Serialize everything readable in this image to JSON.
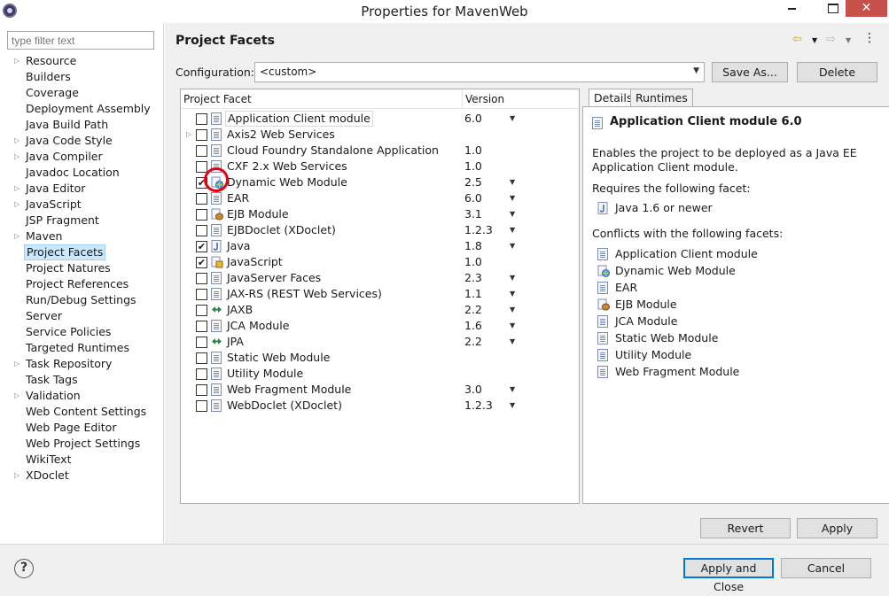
{
  "window": {
    "title": "Properties for MavenWeb",
    "close_glyph": "✕"
  },
  "sidebar": {
    "filter_placeholder": "type filter text",
    "items": [
      {
        "label": "Resource",
        "expandable": true
      },
      {
        "label": "Builders",
        "expandable": false
      },
      {
        "label": "Coverage",
        "expandable": false
      },
      {
        "label": "Deployment Assembly",
        "expandable": false
      },
      {
        "label": "Java Build Path",
        "expandable": false
      },
      {
        "label": "Java Code Style",
        "expandable": true
      },
      {
        "label": "Java Compiler",
        "expandable": true
      },
      {
        "label": "Javadoc Location",
        "expandable": false
      },
      {
        "label": "Java Editor",
        "expandable": true
      },
      {
        "label": "JavaScript",
        "expandable": true
      },
      {
        "label": "JSP Fragment",
        "expandable": false
      },
      {
        "label": "Maven",
        "expandable": true
      },
      {
        "label": "Project Facets",
        "expandable": false,
        "selected": true
      },
      {
        "label": "Project Natures",
        "expandable": false
      },
      {
        "label": "Project References",
        "expandable": false
      },
      {
        "label": "Run/Debug Settings",
        "expandable": false
      },
      {
        "label": "Server",
        "expandable": false
      },
      {
        "label": "Service Policies",
        "expandable": false
      },
      {
        "label": "Targeted Runtimes",
        "expandable": false
      },
      {
        "label": "Task Repository",
        "expandable": true
      },
      {
        "label": "Task Tags",
        "expandable": false
      },
      {
        "label": "Validation",
        "expandable": true
      },
      {
        "label": "Web Content Settings",
        "expandable": false
      },
      {
        "label": "Web Page Editor",
        "expandable": false
      },
      {
        "label": "Web Project Settings",
        "expandable": false
      },
      {
        "label": "WikiText",
        "expandable": false
      },
      {
        "label": "XDoclet",
        "expandable": true
      }
    ]
  },
  "main": {
    "title": "Project Facets",
    "configuration_label": "Configuration:",
    "configuration_value": "<custom>",
    "save_as_label": "Save As...",
    "delete_label": "Delete",
    "facets_header": "Project Facet",
    "version_header": "Version",
    "facets": [
      {
        "name": "Application Client module",
        "version": "6.0",
        "checked": false,
        "dropdown": true,
        "boxed": true,
        "expandable": false,
        "icon": "page-icon"
      },
      {
        "name": "Axis2 Web Services",
        "version": "",
        "checked": false,
        "dropdown": false,
        "expandable": true,
        "icon": "page-icon"
      },
      {
        "name": "Cloud Foundry Standalone Application",
        "version": "1.0",
        "checked": false,
        "dropdown": false,
        "expandable": false,
        "icon": "page-icon"
      },
      {
        "name": "CXF 2.x Web Services",
        "version": "1.0",
        "checked": false,
        "dropdown": false,
        "expandable": false,
        "icon": "page-icon"
      },
      {
        "name": "Dynamic Web Module",
        "version": "2.5",
        "checked": true,
        "dropdown": true,
        "expandable": false,
        "icon": "globe-page-icon"
      },
      {
        "name": "EAR",
        "version": "6.0",
        "checked": false,
        "dropdown": true,
        "expandable": false,
        "icon": "page-icon"
      },
      {
        "name": "EJB Module",
        "version": "3.1",
        "checked": false,
        "dropdown": true,
        "expandable": false,
        "icon": "bean-icon"
      },
      {
        "name": "EJBDoclet (XDoclet)",
        "version": "1.2.3",
        "checked": false,
        "dropdown": true,
        "expandable": false,
        "icon": "page-icon"
      },
      {
        "name": "Java",
        "version": "1.8",
        "checked": true,
        "dropdown": true,
        "expandable": false,
        "icon": "java-page-icon"
      },
      {
        "name": "JavaScript",
        "version": "1.0",
        "checked": true,
        "dropdown": false,
        "expandable": false,
        "icon": "js-icon"
      },
      {
        "name": "JavaServer Faces",
        "version": "2.3",
        "checked": false,
        "dropdown": true,
        "expandable": false,
        "icon": "page-icon"
      },
      {
        "name": "JAX-RS (REST Web Services)",
        "version": "1.1",
        "checked": false,
        "dropdown": true,
        "expandable": false,
        "icon": "page-icon"
      },
      {
        "name": "JAXB",
        "version": "2.2",
        "checked": false,
        "dropdown": true,
        "expandable": false,
        "icon": "arrows-icon"
      },
      {
        "name": "JCA Module",
        "version": "1.6",
        "checked": false,
        "dropdown": true,
        "expandable": false,
        "icon": "page-icon"
      },
      {
        "name": "JPA",
        "version": "2.2",
        "checked": false,
        "dropdown": true,
        "expandable": false,
        "icon": "arrows-icon"
      },
      {
        "name": "Static Web Module",
        "version": "",
        "checked": false,
        "dropdown": false,
        "expandable": false,
        "icon": "page-icon"
      },
      {
        "name": "Utility Module",
        "version": "",
        "checked": false,
        "dropdown": false,
        "expandable": false,
        "icon": "page-icon"
      },
      {
        "name": "Web Fragment Module",
        "version": "3.0",
        "checked": false,
        "dropdown": true,
        "expandable": false,
        "icon": "page-icon"
      },
      {
        "name": "WebDoclet (XDoclet)",
        "version": "1.2.3",
        "checked": false,
        "dropdown": true,
        "expandable": false,
        "icon": "page-icon"
      }
    ],
    "details": {
      "tab_details": "Details",
      "tab_runtimes": "Runtimes",
      "title": "Application Client module 6.0",
      "description": "Enables the project to be deployed as a Java EE Application Client module.",
      "requires_label": "Requires the following facet:",
      "requires": [
        {
          "label": "Java 1.6 or newer",
          "icon": "java-page-icon"
        }
      ],
      "conflicts_label": "Conflicts with the following facets:",
      "conflicts": [
        {
          "label": "Application Client module",
          "icon": "page-icon"
        },
        {
          "label": "Dynamic Web Module",
          "icon": "globe-page-icon"
        },
        {
          "label": "EAR",
          "icon": "page-icon"
        },
        {
          "label": "EJB Module",
          "icon": "bean-icon"
        },
        {
          "label": "JCA Module",
          "icon": "page-icon"
        },
        {
          "label": "Static Web Module",
          "icon": "page-icon"
        },
        {
          "label": "Utility Module",
          "icon": "page-icon"
        },
        {
          "label": "Web Fragment Module",
          "icon": "page-icon"
        }
      ]
    },
    "revert_label": "Revert",
    "apply_label": "Apply"
  },
  "footer": {
    "help_glyph": "?",
    "apply_close_label": "Apply and Close",
    "cancel_label": "Cancel"
  },
  "colors": {
    "selection": "#cce8ff",
    "highlight_ring": "#e60012",
    "primary_border": "#0078d7"
  }
}
